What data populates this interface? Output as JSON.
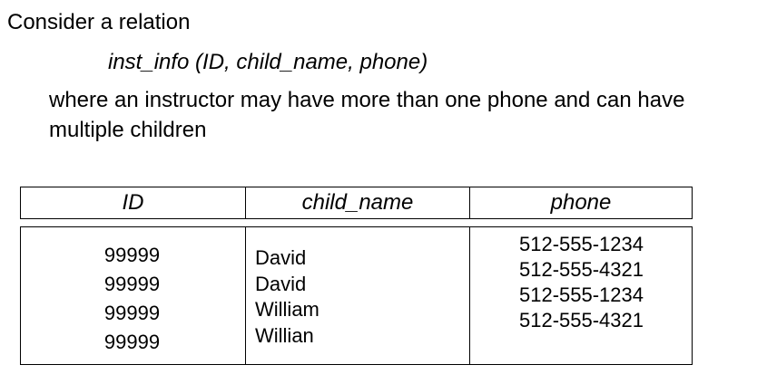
{
  "intro": "Consider a relation",
  "relation": "inst_info (ID, child_name, phone)",
  "description": {
    "line1": "where an instructor may have more than one phone and can have",
    "line2": "multiple children"
  },
  "table": {
    "headers": [
      "ID",
      "child_name",
      "phone"
    ],
    "ids": [
      "99999",
      "99999",
      "99999",
      "99999"
    ],
    "child_names": [
      "David",
      "David",
      "William",
      "Willian"
    ],
    "phones": [
      "512-555-1234",
      "512-555-4321",
      "512-555-1234",
      "512-555-4321"
    ]
  }
}
